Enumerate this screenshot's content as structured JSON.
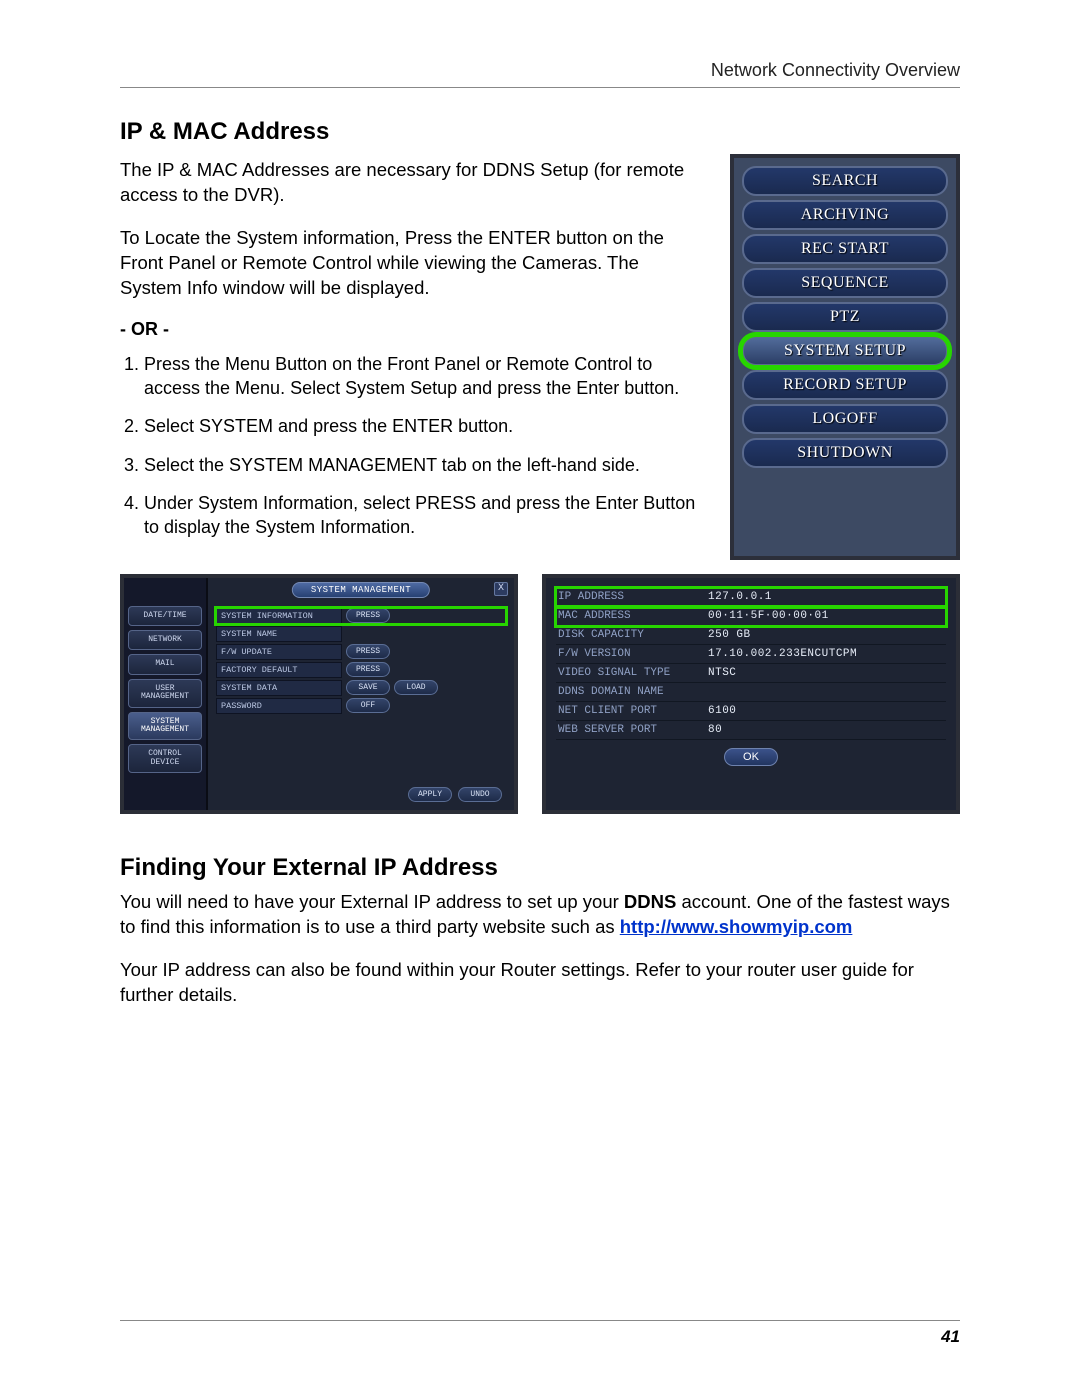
{
  "header": {
    "section": "Network Connectivity Overview"
  },
  "sec1": {
    "title": "IP & MAC Address",
    "p1": "The IP & MAC Addresses are necessary for DDNS Setup (for remote access to the DVR).",
    "p2": "To Locate the System information, Press the ENTER button on the Front Panel or Remote Control while viewing the Cameras. The System Info window will be displayed.",
    "or": "- OR -",
    "steps": [
      "Press the Menu Button on the Front Panel or Remote Control to access the Menu. Select System Setup and press the Enter button.",
      "Select SYSTEM and press the ENTER button.",
      "Select the SYSTEM MANAGEMENT tab on the left-hand side.",
      "Under System Information, select PRESS and press the Enter Button to display the System Information."
    ]
  },
  "dvrMenu": {
    "items": [
      {
        "label": "SEARCH",
        "hl": false
      },
      {
        "label": "ARCHVING",
        "hl": false
      },
      {
        "label": "REC START",
        "hl": false
      },
      {
        "label": "SEQUENCE",
        "hl": false
      },
      {
        "label": "PTZ",
        "hl": false
      },
      {
        "label": "SYSTEM SETUP",
        "hl": true
      },
      {
        "label": "RECORD SETUP",
        "hl": false
      },
      {
        "label": "LOGOFF",
        "hl": false
      },
      {
        "label": "SHUTDOWN",
        "hl": false
      }
    ]
  },
  "sysMgmt": {
    "title": "SYSTEM MANAGEMENT",
    "close": "X",
    "tabs": [
      "DATE/TIME",
      "NETWORK",
      "MAIL",
      "USER\nMANAGEMENT",
      "SYSTEM\nMANAGEMENT",
      "CONTROL\nDEVICE"
    ],
    "selectedTab": 4,
    "rows": [
      {
        "label": "SYSTEM INFORMATION",
        "ctrls": [
          "PRESS"
        ],
        "hl": true
      },
      {
        "label": "SYSTEM NAME",
        "ctrls": [],
        "hl": false
      },
      {
        "label": "F/W UPDATE",
        "ctrls": [
          "PRESS"
        ],
        "hl": false
      },
      {
        "label": "FACTORY DEFAULT",
        "ctrls": [
          "PRESS"
        ],
        "hl": false
      },
      {
        "label": "SYSTEM DATA",
        "ctrls": [
          "SAVE",
          "LOAD"
        ],
        "hl": false
      },
      {
        "label": "PASSWORD",
        "ctrls": [
          "OFF"
        ],
        "hl": false
      }
    ],
    "footer": [
      "APPLY",
      "UNDO"
    ]
  },
  "sysInfo": {
    "rows": [
      {
        "k": "IP ADDRESS",
        "v": "127.0.0.1",
        "hl": true
      },
      {
        "k": "MAC ADDRESS",
        "v": "00·11·5F·00·00·01",
        "hl": true
      },
      {
        "k": "DISK CAPACITY",
        "v": "250 GB",
        "hl": false
      },
      {
        "k": "F/W VERSION",
        "v": "17.10.002.233ENCUTCPM",
        "hl": false
      },
      {
        "k": "VIDEO SIGNAL TYPE",
        "v": "NTSC",
        "hl": false
      },
      {
        "k": "DDNS DOMAIN NAME",
        "v": "",
        "hl": false
      },
      {
        "k": "NET CLIENT PORT",
        "v": "6100",
        "hl": false
      },
      {
        "k": "WEB SERVER PORT",
        "v": "80",
        "hl": false
      }
    ],
    "ok": "OK"
  },
  "sec2": {
    "title": "Finding Your External IP Address",
    "p1a": "You will need to have your External IP address to set up your ",
    "p1b": "DDNS",
    "p1c": " account. One of the fastest ways to find this information is to use a third party website such as ",
    "link": "http://www.showmyip.com",
    "p2": "Your IP address can also be found within your Router settings. Refer to your router user guide for further details."
  },
  "footer": {
    "page": "41"
  }
}
